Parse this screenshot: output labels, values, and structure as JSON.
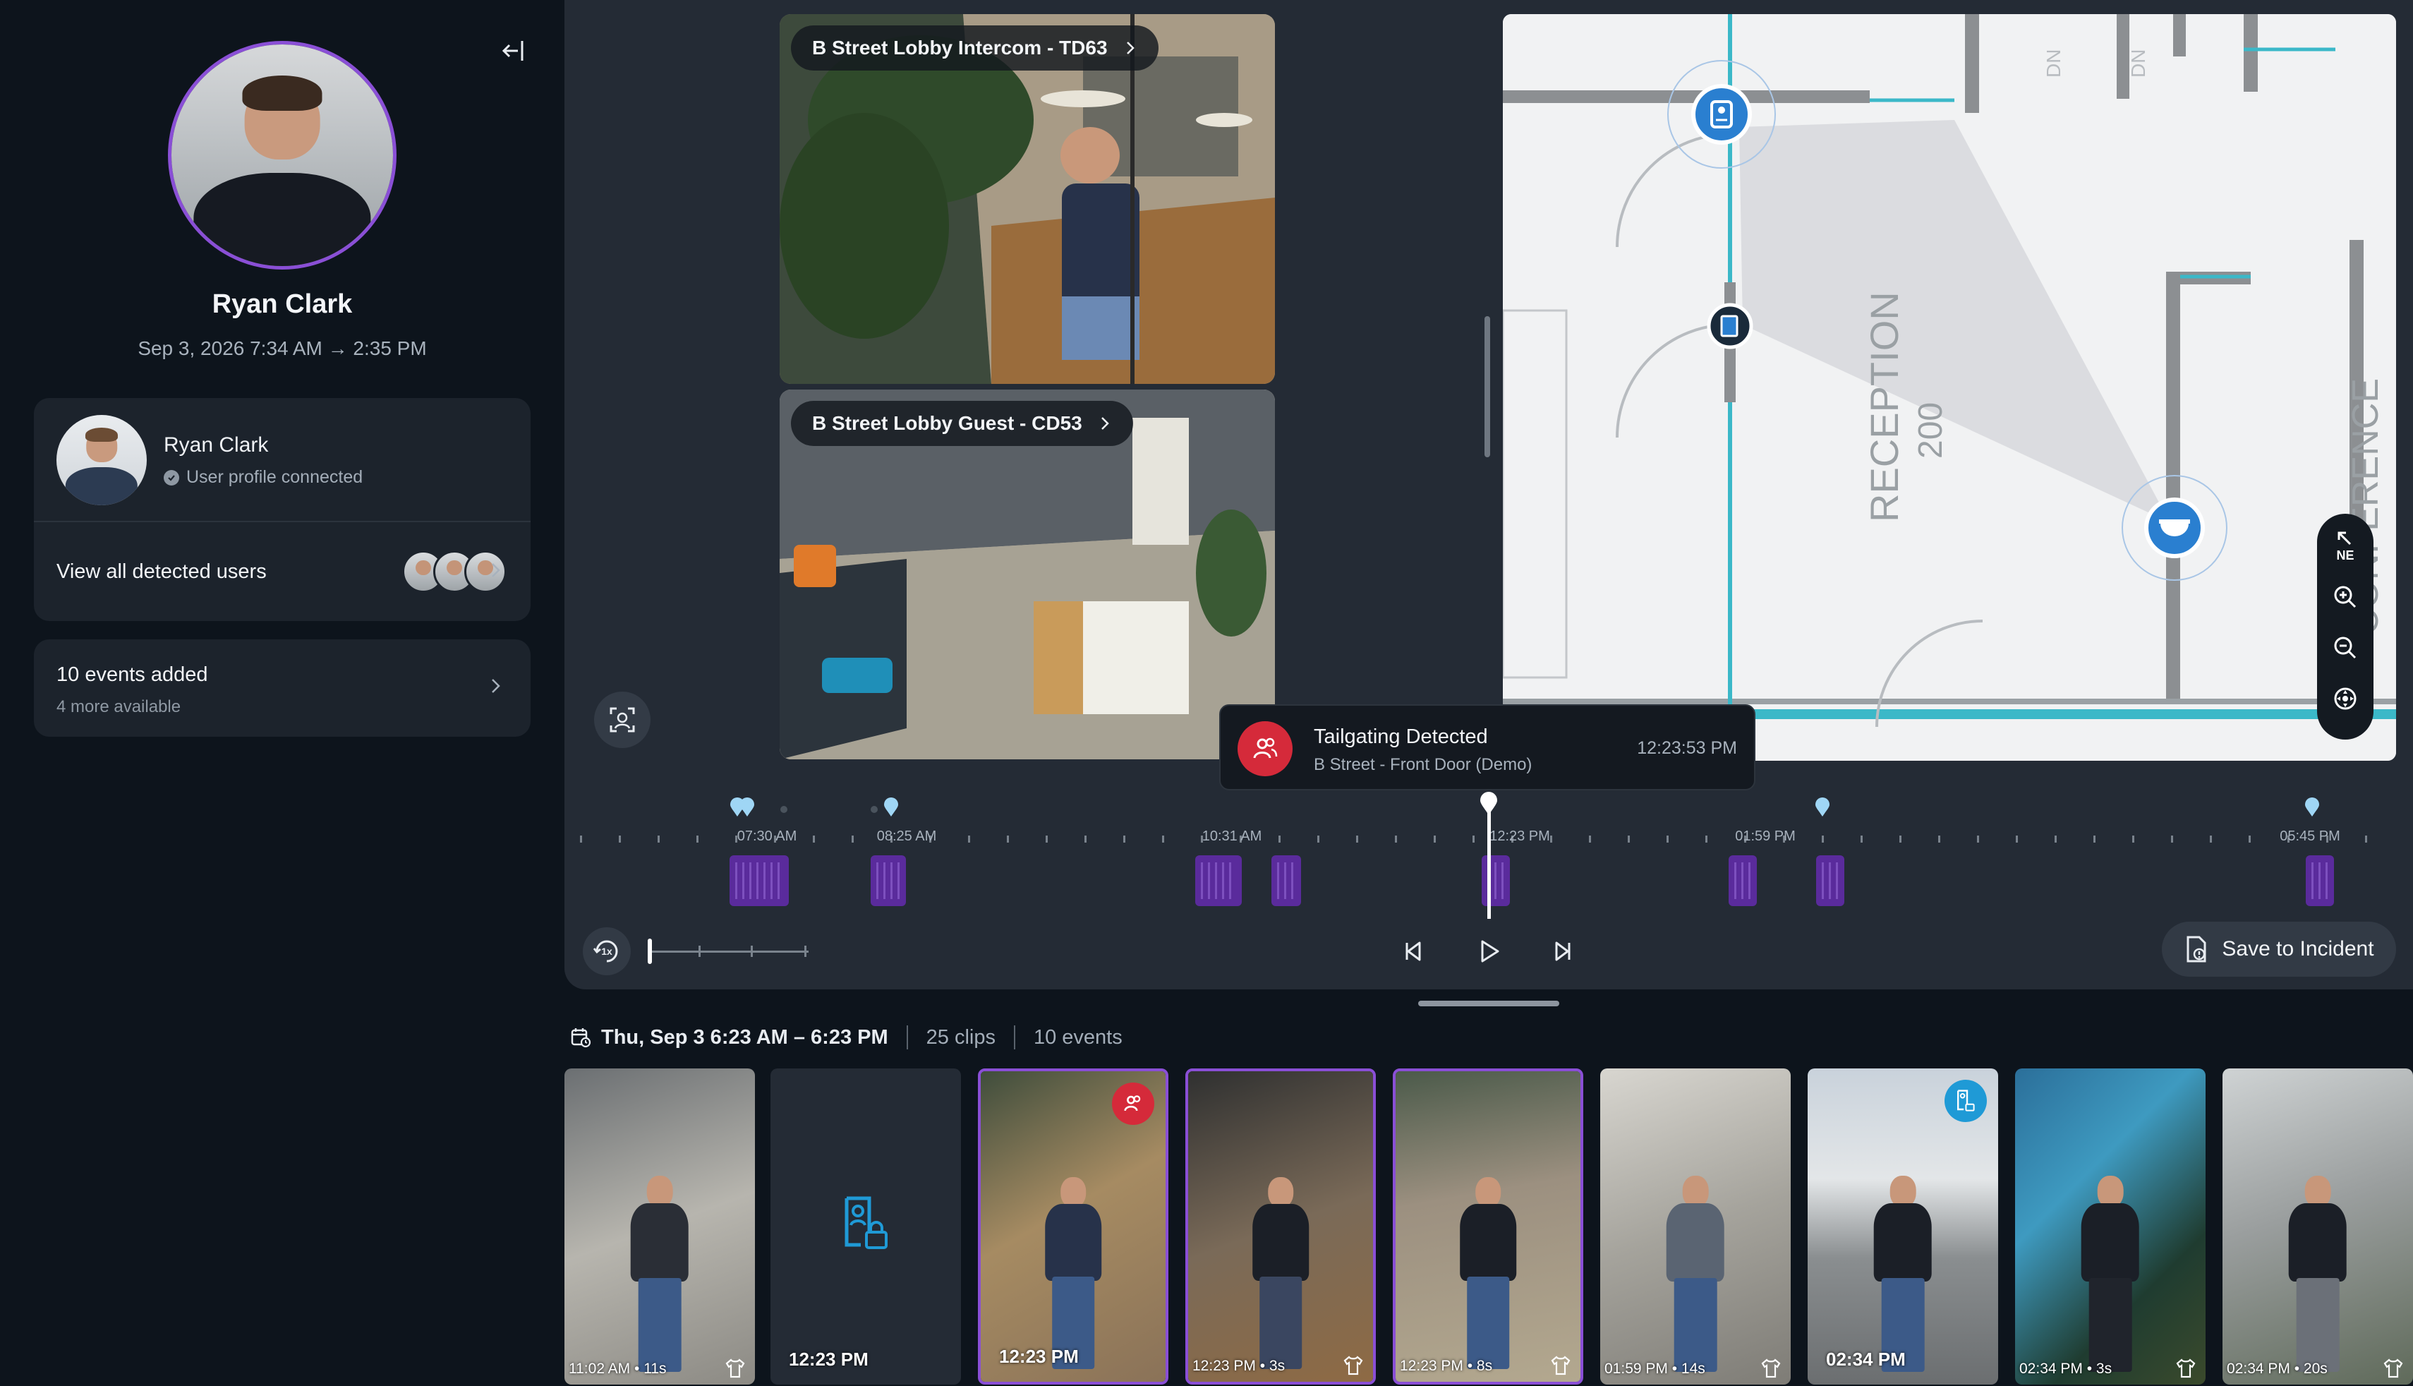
{
  "sidebar": {
    "profile_name": "Ryan Clark",
    "profile_range": "Sep 3, 2026 7:34 AM → 2:35 PM",
    "user_card": {
      "name": "Ryan Clark",
      "status": "User profile connected"
    },
    "view_users_label": "View all detected users",
    "events": {
      "title": "10 events added",
      "subtitle": "4 more available"
    }
  },
  "cameras": [
    {
      "label": "B Street Lobby Intercom - TD63"
    },
    {
      "label": "B Street Lobby Guest - CD53"
    }
  ],
  "map": {
    "room_label": "RECEPTION",
    "room_number": "200",
    "side_label": "CONFERENCE",
    "dn_label": "DN",
    "compass_label": "NE"
  },
  "alert": {
    "title": "Tailgating Detected",
    "subtitle": "B Street - Front Door (Demo)",
    "time": "12:23:53 PM",
    "accent_color": "#d52a3a"
  },
  "timeline": {
    "labels": [
      "07:30 AM",
      "08:25 AM",
      "10:31 AM",
      "12:23 PM",
      "01:59 PM",
      "05:45 PM"
    ],
    "playhead_label": "12:23 PM"
  },
  "playback": {
    "speed_label": "1x",
    "save_label": "Save to Incident"
  },
  "clips_header": {
    "date_range": "Thu, Sep 3 6:23 AM – 6:23 PM",
    "clips_count": "25 clips",
    "events_count": "10 events"
  },
  "thumbnails": [
    {
      "caption": "11:02 AM • 11s",
      "style": "small"
    },
    {
      "caption": "12:23 PM",
      "style": "big"
    },
    {
      "caption": "12:23 PM",
      "style": "big"
    },
    {
      "caption": "12:23 PM • 3s",
      "style": "small"
    },
    {
      "caption": "12:23 PM • 8s",
      "style": "small"
    },
    {
      "caption": "01:59 PM • 14s",
      "style": "small"
    },
    {
      "caption": "02:34 PM",
      "style": "big"
    },
    {
      "caption": "02:34 PM • 3s",
      "style": "small"
    },
    {
      "caption": "02:34 PM • 20s",
      "style": "small"
    }
  ],
  "colors": {
    "accent_purple": "#8a4fd6",
    "map_cyan": "#3bb8c8",
    "camera_blue": "#2a7fd0",
    "badge_blue": "#1f9ad6"
  }
}
